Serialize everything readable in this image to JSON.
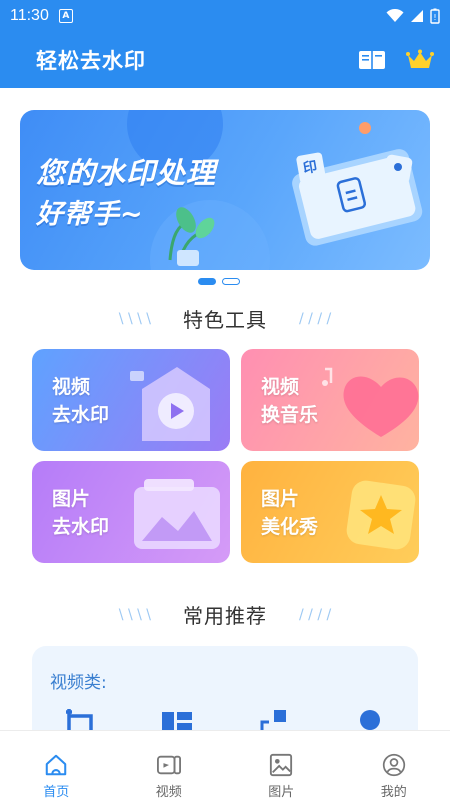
{
  "status_bar": {
    "time": "11:30",
    "indicator": "A"
  },
  "header": {
    "title": "轻松去水印",
    "icons": [
      "book-icon",
      "crown-icon"
    ],
    "accent": "#2b8cf0"
  },
  "banner": {
    "line1": "您的水印处理",
    "line2": "好帮手~",
    "stamp": "印"
  },
  "featured": {
    "title": "特色工具",
    "deco_left": "\\ \\ \\ \\",
    "deco_right": "/ / / /",
    "tools": [
      {
        "line1": "视频",
        "line2": "去水印",
        "colors": [
          "#5fa2ff",
          "#9b7cf5"
        ]
      },
      {
        "line1": "视频",
        "line2": "换音乐",
        "colors": [
          "#ff8fb2",
          "#ffb3a0"
        ]
      },
      {
        "line1": "图片",
        "line2": "去水印",
        "colors": [
          "#b57cf8",
          "#d59bf7"
        ]
      },
      {
        "line1": "图片",
        "line2": "美化秀",
        "colors": [
          "#ffb23f",
          "#ffcd5a"
        ]
      }
    ]
  },
  "recommend": {
    "title": "常用推荐",
    "deco_left": "\\ \\ \\ \\",
    "deco_right": "/ / / /",
    "category": "视频类:"
  },
  "bottom_nav": [
    {
      "label": "首页",
      "icon": "home-icon",
      "active": true
    },
    {
      "label": "视频",
      "icon": "video-icon",
      "active": false
    },
    {
      "label": "图片",
      "icon": "image-icon",
      "active": false
    },
    {
      "label": "我的",
      "icon": "profile-icon",
      "active": false
    }
  ]
}
